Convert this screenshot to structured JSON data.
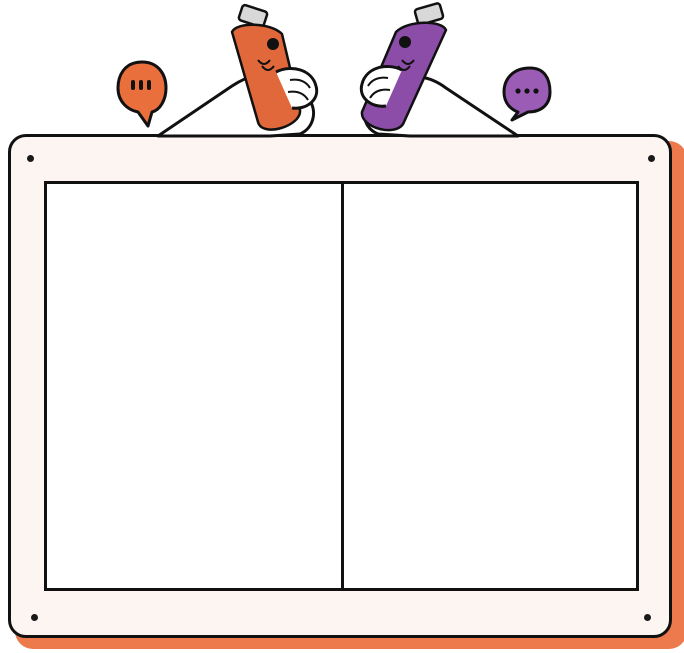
{
  "board": {
    "frame_color": "#fdf5f1",
    "shadow_color": "#ed7a4c",
    "outline_color": "#111111"
  },
  "panels": {
    "count": 2,
    "fill": "#ffffff"
  },
  "characters": [
    {
      "name": "left",
      "bottle_color": "#e0683a",
      "speech_bubble_color": "#e9703d",
      "bubble_icon": "ellipsis-icon"
    },
    {
      "name": "right",
      "bottle_color": "#8b4da8",
      "speech_bubble_color": "#9a5cb5",
      "bubble_icon": "ellipsis-icon"
    }
  ]
}
